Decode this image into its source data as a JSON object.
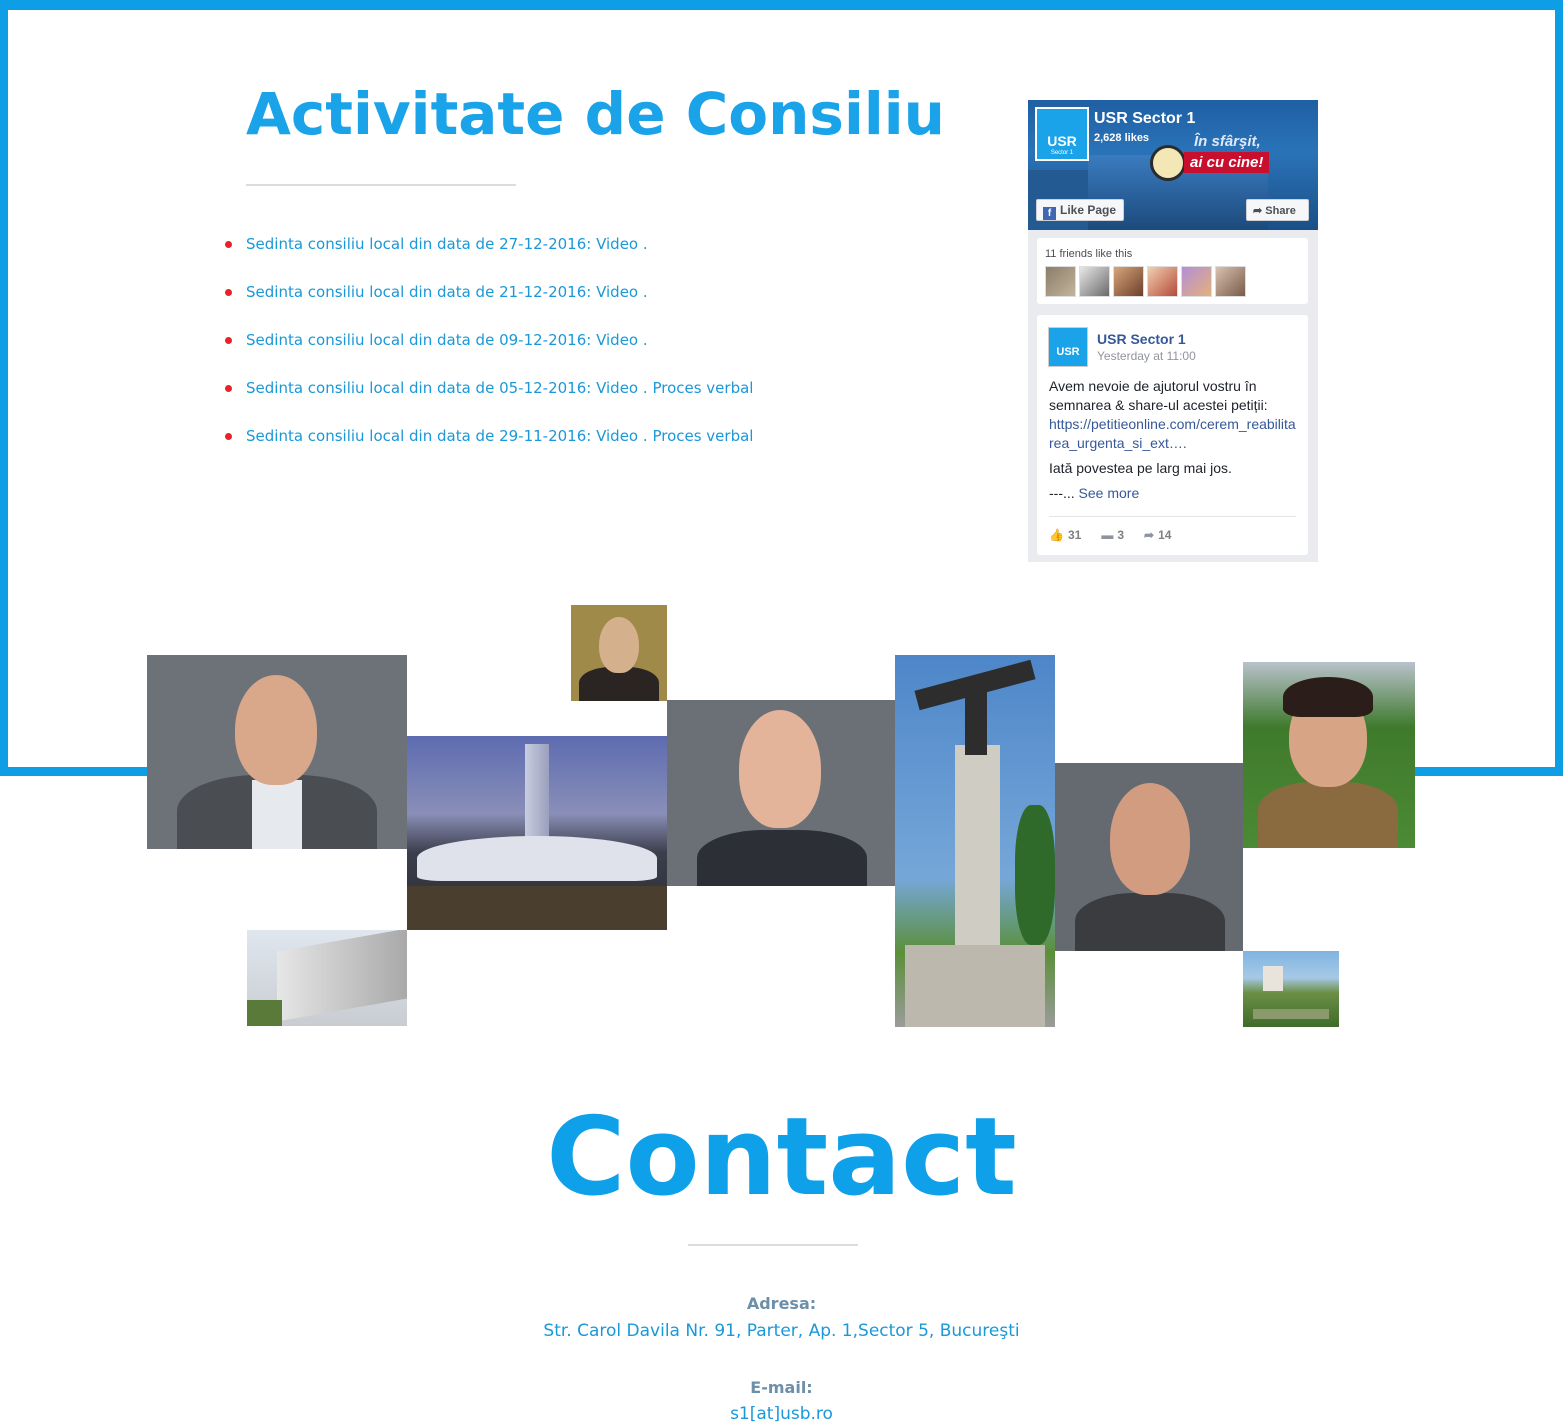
{
  "section": {
    "title": "Activitate de Consiliu",
    "meetings": [
      {
        "text": "Sedinta consiliu local din data de 27-12-2016:",
        "video": "Video",
        "sep": ".",
        "proces": ""
      },
      {
        "text": "Sedinta consiliu local din data de 21-12-2016:",
        "video": "Video",
        "sep": ".",
        "proces": ""
      },
      {
        "text": "Sedinta consiliu local din data de 09-12-2016:",
        "video": "Video",
        "sep": ".",
        "proces": ""
      },
      {
        "text": "Sedinta consiliu local din data de 05-12-2016:",
        "video": "Video",
        "sep": ".",
        "proces": "Proces verbal"
      },
      {
        "text": "Sedinta consiliu local din data de 29-11-2016:",
        "video": "Video",
        "sep": ".",
        "proces": "Proces verbal"
      }
    ],
    "bullet_color": "#e4252a",
    "accent_color": "#1aa3e8"
  },
  "facebook": {
    "page_name": "USR Sector 1",
    "likes": "2,628 likes",
    "logo_text": "USR",
    "logo_sub": "Sector 1",
    "cover_line1": "În sfârşit,",
    "cover_line2": "ai cu cine!",
    "like_button": "Like Page",
    "share_button": "Share",
    "friends_text": "11 friends like this",
    "post": {
      "author": "USR Sector 1",
      "time": "Yesterday at 11:00",
      "text": "Avem nevoie de ajutorul vostru în semnarea & share-ul acestei petiții:",
      "link": "https://petitieonline.com/cerem_reabilitarea_urgenta_si_ext….",
      "text2": "Iată povestea pe larg mai jos.",
      "text3_prefix": "---...",
      "see_more": "See more",
      "likes": "31",
      "comments": "3",
      "shares": "14"
    }
  },
  "contact": {
    "title": "Contact",
    "address_label": "Adresa:",
    "address": "Str. Carol Davila Nr. 91, Parter, Ap. 1,Sector 5, Bucureşti",
    "email_label": "E-mail:",
    "email": "s1[at]usb.ro"
  }
}
